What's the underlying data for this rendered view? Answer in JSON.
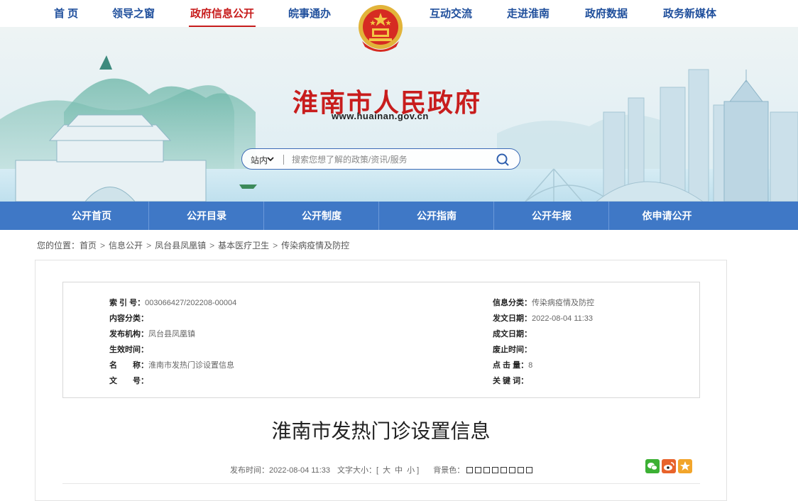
{
  "topnav": [
    {
      "label": "首 页"
    },
    {
      "label": "领导之窗"
    },
    {
      "label": "政府信息公开"
    },
    {
      "label": "皖事通办"
    },
    {
      "label": "互动交流"
    },
    {
      "label": "走进淮南"
    },
    {
      "label": "政府数据"
    },
    {
      "label": "政务新媒体"
    }
  ],
  "header": {
    "title": "淮南市人民政府",
    "url": "www.huainan.gov.cn"
  },
  "search": {
    "scope": "站内",
    "placeholder": "搜索您想了解的政策/资讯/服务"
  },
  "subnav": [
    {
      "label": "公开首页"
    },
    {
      "label": "公开目录"
    },
    {
      "label": "公开制度"
    },
    {
      "label": "公开指南"
    },
    {
      "label": "公开年报"
    },
    {
      "label": "依申请公开"
    }
  ],
  "breadcrumb": {
    "prefix": "您的位置：",
    "items": [
      "首页",
      "信息公开",
      "凤台县凤凰镇",
      "基本医疗卫生",
      "传染病疫情及防控"
    ]
  },
  "meta": {
    "index_label": "索 引 号：",
    "index_value": "003066427/202208-00004",
    "content_cat_label": "内容分类：",
    "content_cat_value": "",
    "issuer_label": "发布机构：",
    "issuer_value": "凤台县凤凰镇",
    "effective_label": "生效时间：",
    "effective_value": "",
    "name_label": "名　　称：",
    "name_value": "淮南市发热门诊设置信息",
    "docno_label": "文　　号：",
    "docno_value": "",
    "info_cat_label": "信息分类：",
    "info_cat_value": "传染病疫情及防控",
    "issue_date_label": "发文日期：",
    "issue_date_value": "2022-08-04 11:33",
    "made_date_label": "成文日期：",
    "made_date_value": "",
    "expire_label": "废止时间：",
    "expire_value": "",
    "clicks_label": "点 击 量：",
    "clicks_value": "8",
    "keywords_label": "关 键 词：",
    "keywords_value": ""
  },
  "article": {
    "title": "淮南市发热门诊设置信息",
    "published_label": "发布时间：2022-08-04 11:33",
    "fontsize_label": "文字大小：[",
    "font_large": "大",
    "font_medium": "中",
    "font_small": "小",
    "fontsize_close": "]",
    "bg_label": "背景色："
  },
  "colors": {
    "nav_blue": "#1f4f9c",
    "nav_active": "#c71c1c",
    "subnav_bg": "#3f78c6",
    "wechat": "#3cb034",
    "weibo": "#e8632b",
    "favorite": "#f2a52a"
  },
  "icons": {
    "search": "search-icon",
    "chevron": "chevron-down-icon",
    "wechat": "wechat-icon",
    "weibo": "weibo-icon",
    "favorite": "star-icon",
    "emblem": "national-emblem-icon"
  }
}
